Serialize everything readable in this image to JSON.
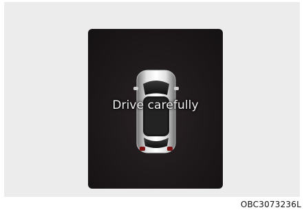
{
  "display": {
    "message": "Drive carefully",
    "car_icon": "car-rear-view-icon"
  },
  "figure": {
    "code": "OBC3073236L"
  },
  "colors": {
    "display_background": "#1f1a1c",
    "message_text": "#f2f2f2",
    "page_background": "#ececec"
  }
}
